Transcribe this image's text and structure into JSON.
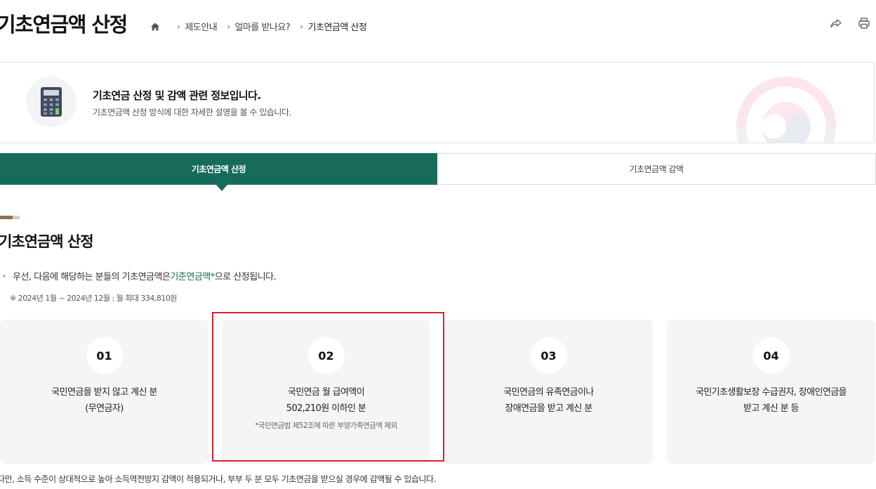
{
  "header": {
    "title": "기초연금액 산정",
    "breadcrumb": [
      "제도안내",
      "얼마를 받나요?",
      "기초연금액 산정"
    ]
  },
  "info_banner": {
    "title": "기초연금 산정 및 감액 관련 정보입니다.",
    "description": "기초연금액 산정 방식에 대한 자세한 설명을 볼 수 있습니다."
  },
  "tabs": [
    {
      "label": "기초연금액 산정",
      "active": true
    },
    {
      "label": "기초연금액 감액",
      "active": false
    }
  ],
  "section": {
    "title": "기초연금액 산정",
    "intro_prefix": "우선, 다음에 해당하는 분들의 기초연금액은 ",
    "intro_highlight": "기준연금액*",
    "intro_suffix": "으로 산정됩니다.",
    "note": "※ 2024년 1월 ~ 2024년 12월 : 월 최대 334,810원"
  },
  "cards": [
    {
      "num": "01",
      "line1": "국민연금을 받지 않고 계신 분",
      "line2": "(무연금자)",
      "sub": ""
    },
    {
      "num": "02",
      "line1": "국민연금 월 급여액이",
      "line2": "502,210원 이하인 분",
      "sub": "*국민연금법 제52조에 따른 부양가족연금액 제외"
    },
    {
      "num": "03",
      "line1": "국민연금의 유족연금이나",
      "line2": "장애연금을 받고 계신 분",
      "sub": ""
    },
    {
      "num": "04",
      "line1": "국민기초생활보장 수급권자, 장애인연금을",
      "line2": "받고 계신 분 등",
      "sub": ""
    }
  ],
  "footer_note": "다만, 소득 수준이 상대적으로 높아 소득역전방지 감액이 적용되거나, 부부 두 분 모두 기초연금을 받으실 경우에 감액될 수 있습니다.",
  "colors": {
    "accent": "#176b5b",
    "highlight_border": "#e0202a",
    "card_bg": "#f5f5f5"
  },
  "icons": [
    "home-icon",
    "share-icon",
    "print-icon",
    "calculator-icon",
    "emblem-icon"
  ]
}
